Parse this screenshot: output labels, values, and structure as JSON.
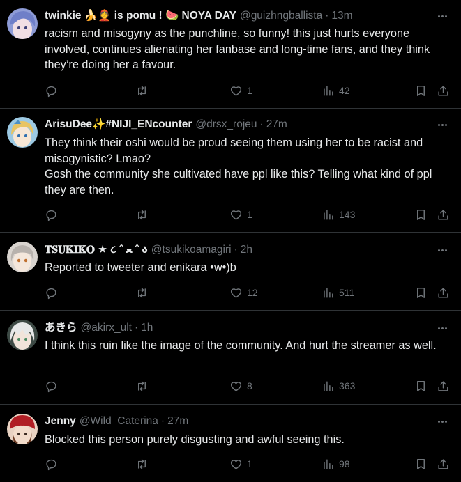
{
  "colors": {
    "background": "#000000",
    "text_primary": "#e7e9ea",
    "text_secondary": "#71767b",
    "divider": "#2f3336"
  },
  "tweets": [
    {
      "avatar_icon": "anime-avatar-blue-hair",
      "name": "twinkie 🍌👲 is pomu ! 🍉 NOYA DAY",
      "handle": "@guizhngballista",
      "time": "13m",
      "text": "racism and misogyny as the punchline, so funny! this just hurts everyone involved, continues alienating her fanbase and long-time fans, and they think they’re doing her a favour.",
      "likes": "1",
      "views": "42"
    },
    {
      "avatar_icon": "anime-avatar-blonde-hair",
      "name": "ArisuDee✨#NIJI_ENcounter",
      "handle": "@drsx_rojeu",
      "time": "27m",
      "text": "They think their oshi would be proud seeing them using her to be racist and misogynistic? Lmao?\nGosh the community she cultivated have ppl like this? Telling what kind of ppl they are then.",
      "likes": "1",
      "views": "143"
    },
    {
      "avatar_icon": "anime-avatar-gray-hair",
      "name": "𝐓𝐒𝐔𝐊𝐈𝐊𝐎 ★ ૮ ˆ ﻌ ˆ ა",
      "handle": "@tsukikoamagiri",
      "time": "2h",
      "text": "Reported to tweeter and enikara •w•)b",
      "likes": "12",
      "views": "511"
    },
    {
      "avatar_icon": "anime-avatar-white-hair",
      "name": "あきら",
      "handle": "@akirx_ult",
      "time": "1h",
      "text": "I think this ruin like the image of the community. And hurt the streamer as well.",
      "likes": "8",
      "views": "363"
    },
    {
      "avatar_icon": "anime-avatar-red-hat",
      "name": "Jenny",
      "handle": "@Wild_Caterina",
      "time": "27m",
      "text": "Blocked this person purely disgusting and awful seeing this.",
      "likes": "1",
      "views": "98"
    }
  ]
}
